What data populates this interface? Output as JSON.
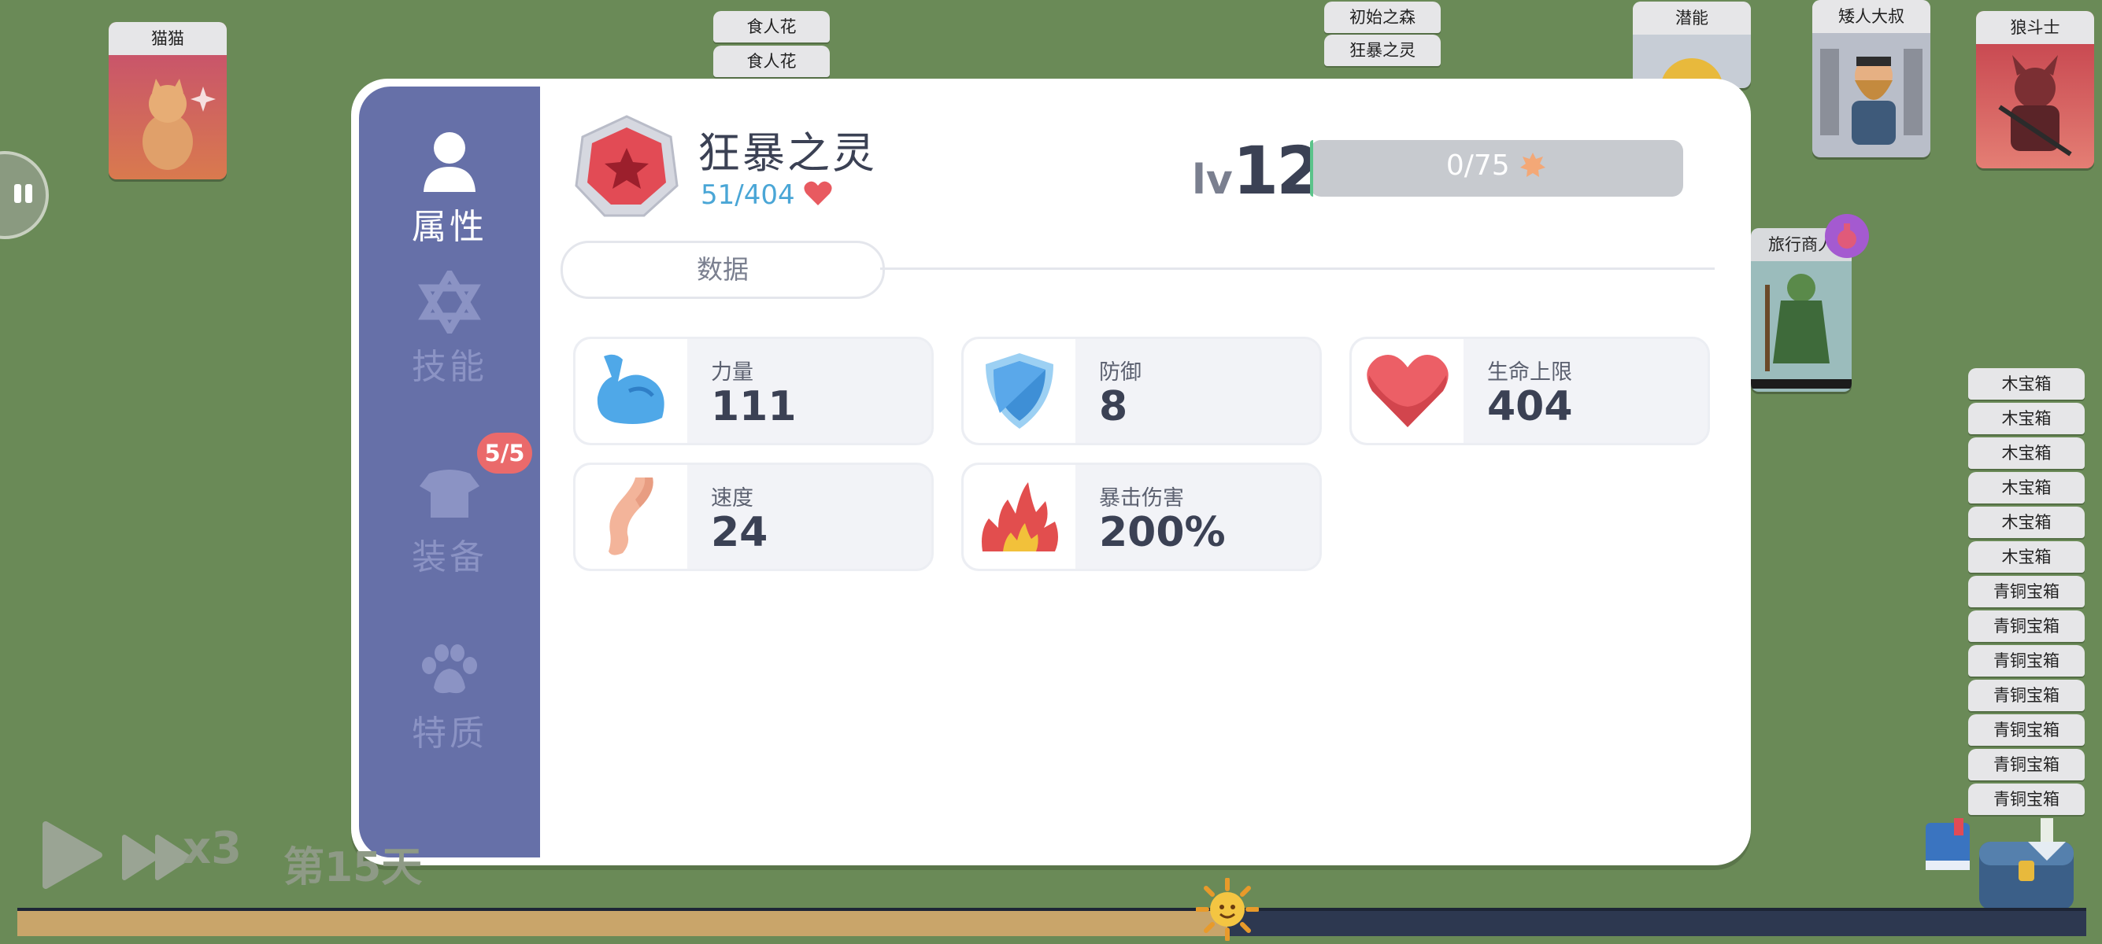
{
  "board": {
    "cards": [
      {
        "id": "cat",
        "label": "猫猫"
      },
      {
        "id": "potential",
        "label": "潜能"
      },
      {
        "id": "dwarf",
        "label": "矮人大叔"
      },
      {
        "id": "wolf",
        "label": "狼斗士"
      },
      {
        "id": "merchant",
        "label": "旅行商人"
      }
    ],
    "stack_tabs": [
      "食人花",
      "食人花",
      "初始之森",
      "狂暴之灵"
    ],
    "chests": [
      "木宝箱",
      "木宝箱",
      "木宝箱",
      "木宝箱",
      "木宝箱",
      "木宝箱",
      "青铜宝箱",
      "青铜宝箱",
      "青铜宝箱",
      "青铜宝箱",
      "青铜宝箱",
      "青铜宝箱",
      "青铜宝箱"
    ]
  },
  "sidebar": {
    "items": [
      {
        "label": "属性",
        "active": true
      },
      {
        "label": "技能",
        "active": false
      },
      {
        "label": "装备",
        "active": false,
        "badge": "5/5"
      },
      {
        "label": "特质",
        "active": false
      }
    ]
  },
  "character": {
    "name": "狂暴之灵",
    "hp": "51/404",
    "level_prefix": "lv",
    "level": "12",
    "xp": "0/75",
    "xp_fraction": 0.0
  },
  "tabs": {
    "active": "数据"
  },
  "stats": [
    {
      "label": "力量",
      "value": "111",
      "icon": "muscle-icon"
    },
    {
      "label": "防御",
      "value": "8",
      "icon": "shield-icon"
    },
    {
      "label": "生命上限",
      "value": "404",
      "icon": "heart-icon"
    },
    {
      "label": "速度",
      "value": "24",
      "icon": "leg-icon"
    },
    {
      "label": "暴击伤害",
      "value": "200%",
      "icon": "explosion-icon"
    }
  ],
  "controls": {
    "speed": "x3",
    "day": "第15天",
    "day_progress": 0.585
  },
  "colors": {
    "sidebar": "#6670a8",
    "background": "#6a8a57",
    "text_dark": "#3b4154",
    "hp_text": "#4aa6d6"
  }
}
